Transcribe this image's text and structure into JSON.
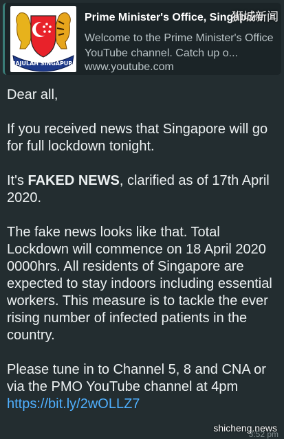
{
  "link_preview": {
    "title": "Prime Minister's Office, Singapore",
    "description": "Welcome to the Prime Minister's Office YouTube channel. Catch up o...",
    "url": "www.youtube.com",
    "thumbnail_icon": "singapore-coat-of-arms",
    "seal_text": "MAJULAH SINGAPURA"
  },
  "watermark_top": "狮城新闻",
  "watermark_bottom": "shicheng.news",
  "message": {
    "greeting": "Dear all,",
    "para1": "If you received news that Singapore will go for full lockdown tonight.",
    "para2_prefix": "It's ",
    "para2_bold": "FAKED NEWS",
    "para2_suffix": ", clarified as of 17th April 2020.",
    "para3": "The fake news looks like that. Total Lockdown will commence on 18 April 2020 0000hrs. All residents of Singapore are expected to stay indoors including essential workers. This measure is to tackle the ever rising number of infected patients in the country.",
    "para4_text": "Please tune in to Channel 5, 8 and CNA or via the PMO YouTube channel at 4pm",
    "para4_link": "https://bit.ly/2wOLLZ7"
  },
  "corner_text": "s",
  "timestamp": "3:52 pm",
  "colors": {
    "background": "#232d30",
    "preview_bg": "#1b2427",
    "link": "#4fb0ff",
    "shield_red": "#e8222a"
  }
}
